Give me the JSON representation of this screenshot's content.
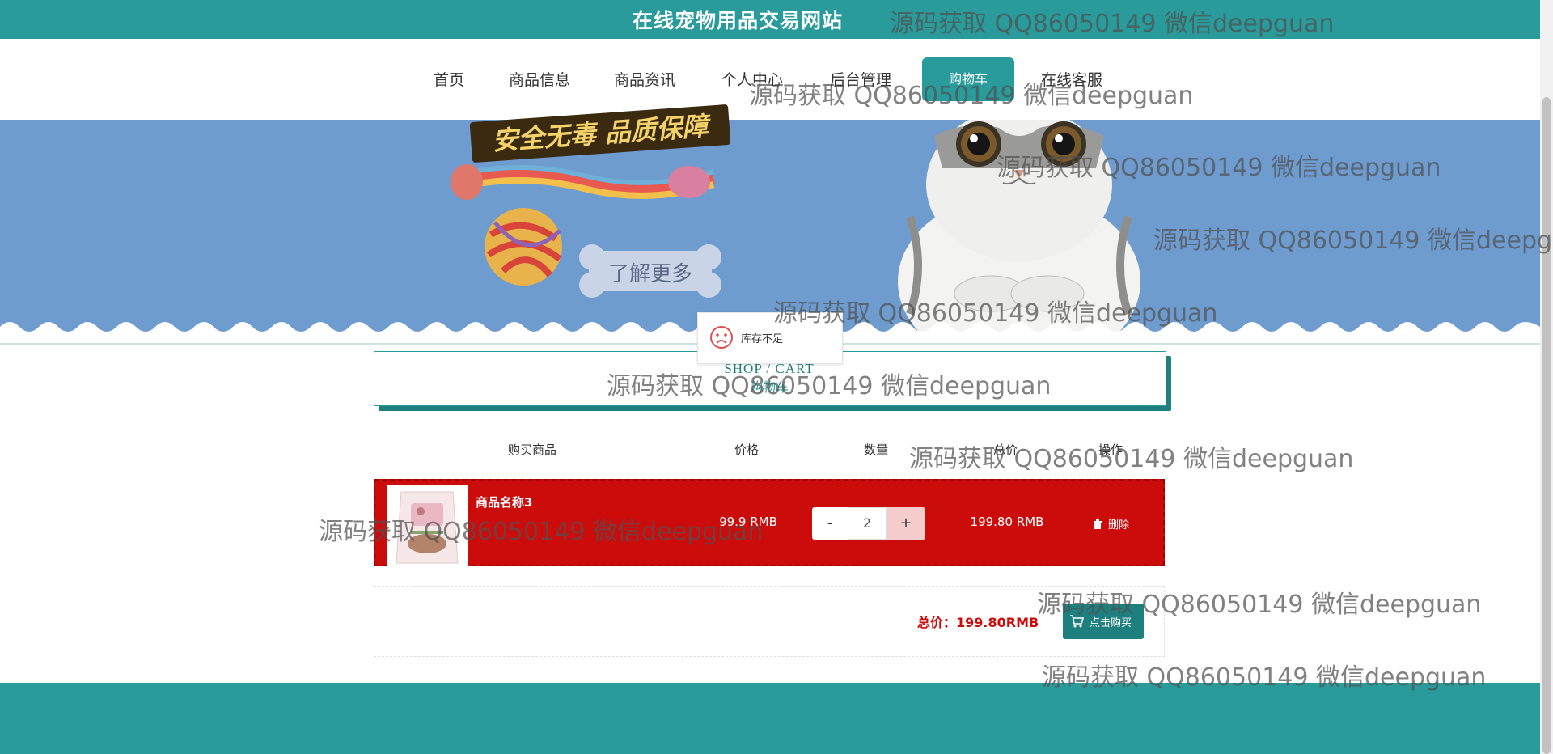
{
  "site_title": "在线宠物用品交易网站",
  "nav": {
    "items": [
      "首页",
      "商品信息",
      "商品资讯",
      "个人中心",
      "后台管理",
      "购物车",
      "在线客服"
    ],
    "active": "购物车"
  },
  "banner": {
    "slogan": "安全无毒 品质保障",
    "learn_more": "了解更多"
  },
  "toast": {
    "icon": "sad-face-icon",
    "message": "库存不足"
  },
  "section_title": {
    "en": "SHOP / CART",
    "cn": "购物车"
  },
  "table": {
    "headers": [
      "购买商品",
      "价格",
      "数量",
      "总价",
      "操作"
    ]
  },
  "cart": {
    "items": [
      {
        "name": "商品名称3",
        "price": "99.9 RMB",
        "minus": "-",
        "quantity": "2",
        "plus": "+",
        "subtotal": "199.80 RMB",
        "delete_label": "删除"
      }
    ]
  },
  "total": {
    "label": "总价：199.80RMB",
    "buy_label": "点击购买"
  },
  "watermark": "源码获取 QQ86050149 微信deepguan",
  "colors": {
    "primary": "#2a9b9b",
    "primary_dark": "#1e7f7f",
    "banner_bg": "#6e9ccf",
    "cart_row": "#cc0b0b"
  }
}
